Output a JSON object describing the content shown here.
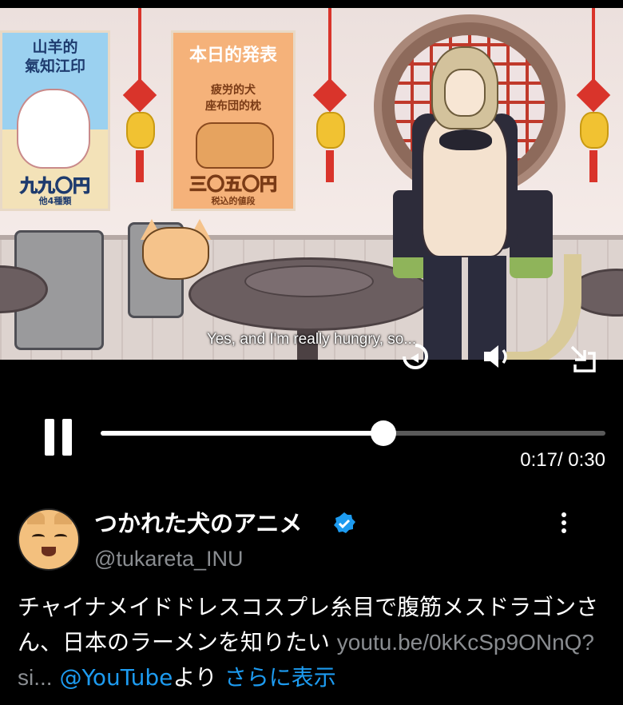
{
  "video": {
    "subtitle": "Yes, and I'm really hungry, so...",
    "posters": {
      "goat": {
        "title": "山羊的\n氣知江印",
        "price": "九九〇円",
        "sub": "他4種類"
      },
      "dog": {
        "title": "本日的発表",
        "subtitle": "疲労的犬\n座布団的枕",
        "price": "三〇五〇円",
        "sub": "税込的値段"
      }
    },
    "controls": {
      "replay_icon": "replay-icon",
      "volume_icon": "volume-icon",
      "exit_fullscreen_icon": "exit-fullscreen-icon"
    }
  },
  "player": {
    "progress": 0.56,
    "time_current": "0:17",
    "time_total": "0:30",
    "time_display": "0:17/ 0:30"
  },
  "tweet": {
    "display_name": "つかれた犬のアニメ",
    "handle": "@tukareta_INU",
    "verified": true,
    "text_main": "チャイナメイドドレスコスプレ糸目で腹筋メスドラゴンさん、日本のラーメンを知りたい ",
    "url_text": "youtu.be/0kKcSp9ONnQ?si...",
    "mention": "@YouTube",
    "via": "より",
    "show_more": "さらに表示"
  },
  "colors": {
    "link": "#1d9bf0",
    "muted": "#8a8d91",
    "background": "#000000"
  }
}
